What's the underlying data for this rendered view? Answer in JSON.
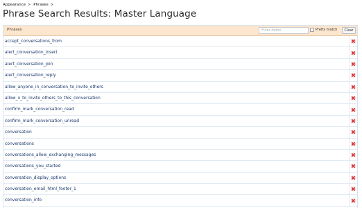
{
  "breadcrumb": {
    "items": [
      "Appearance",
      "Phrases"
    ],
    "separator": ">"
  },
  "page": {
    "title": "Phrase Search Results: Master Language"
  },
  "list": {
    "header_label": "Phrases",
    "filter": {
      "value": "",
      "placeholder": "Filter items"
    },
    "prefix_match": {
      "label": "Prefix match",
      "checked": false
    },
    "clear_label": "Clear",
    "rows": [
      {
        "label": "accept_conversations_from"
      },
      {
        "label": "alert_conversation_insert"
      },
      {
        "label": "alert_conversation_join"
      },
      {
        "label": "alert_conversation_reply"
      },
      {
        "label": "allow_anyone_in_conversation_to_invite_others"
      },
      {
        "label": "allow_x_to_invite_others_to_this_conversation"
      },
      {
        "label": "confirm_mark_conversation_read"
      },
      {
        "label": "confirm_mark_conversation_unread"
      },
      {
        "label": "conversation"
      },
      {
        "label": "conversations"
      },
      {
        "label": "conversations_allow_exchanging_messages"
      },
      {
        "label": "conversations_you_started"
      },
      {
        "label": "conversation_display_options"
      },
      {
        "label": "conversation_email_html_footer_1"
      },
      {
        "label": "conversation_info"
      }
    ],
    "row_icon": "delete-icon"
  },
  "colors": {
    "header_bg": "#fce6ce",
    "link": "#18376b",
    "delete_red": "#d7262a"
  }
}
